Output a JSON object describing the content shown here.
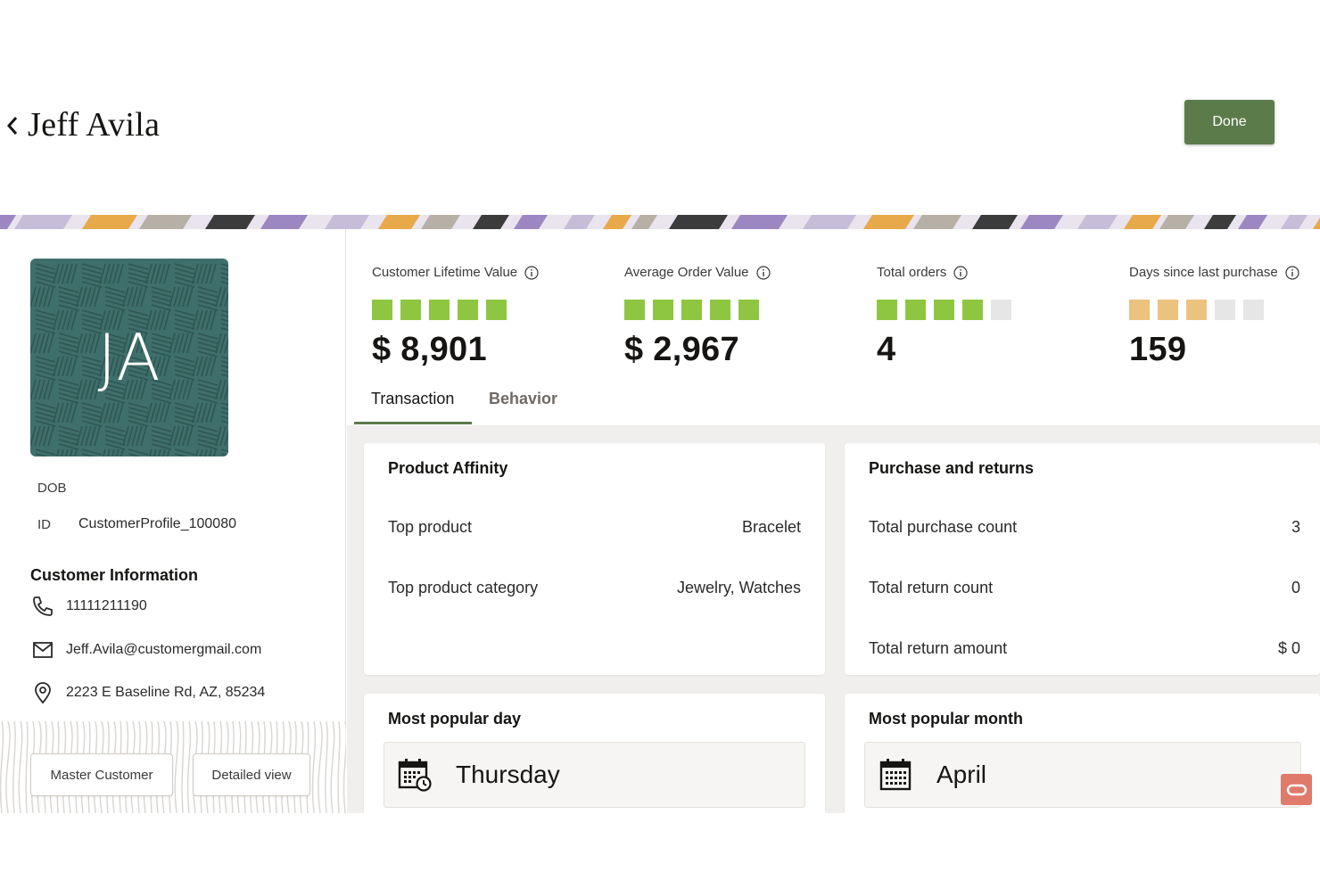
{
  "header": {
    "title": "Jeff Avila",
    "back_icon": "chevron-left-icon",
    "done_label": "Done",
    "accent": "#5c7b4b"
  },
  "profile": {
    "initials": "JA",
    "avatar_color": "#3f6f6b",
    "dob_label": "DOB",
    "id_label": "ID",
    "id_value": "CustomerProfile_100080"
  },
  "customer_info": {
    "title": "Customer Information",
    "phone": "11111211190",
    "email": "Jeff.Avila@customergmail.com",
    "address": "2223 E Baseline Rd, AZ, 85234"
  },
  "footer_buttons": {
    "master": "Master Customer",
    "detailed": "Detailed view"
  },
  "metrics": [
    {
      "label": "Customer Lifetime Value",
      "value": "$ 8,901",
      "level": 5,
      "of": 5,
      "color": "#8fc641"
    },
    {
      "label": "Average Order Value",
      "value": "$ 2,967",
      "level": 5,
      "of": 5,
      "color": "#8fc641"
    },
    {
      "label": "Total orders",
      "value": "4",
      "level": 4,
      "of": 5,
      "color": "#8fc641"
    },
    {
      "label": "Days since last purchase",
      "value": "159",
      "level": 3,
      "of": 5,
      "color": "#ecc27f"
    }
  ],
  "tabs": {
    "transaction": "Transaction",
    "behavior": "Behavior"
  },
  "product_affinity": {
    "title": "Product Affinity",
    "top_product_label": "Top product",
    "top_product_value": "Bracelet",
    "top_category_label": "Top product category",
    "top_category_value": "Jewelry, Watches"
  },
  "purchase_returns": {
    "title": "Purchase and returns",
    "purchase_count_label": "Total purchase count",
    "purchase_count_value": "3",
    "return_count_label": "Total return count",
    "return_count_value": "0",
    "return_amount_label": "Total return amount",
    "return_amount_value": "$ 0"
  },
  "popular_day": {
    "title": "Most popular day",
    "value": "Thursday",
    "icon": "calendar-clock-icon"
  },
  "popular_month": {
    "title": "Most popular month",
    "value": "April",
    "icon": "calendar-icon"
  },
  "colors": {
    "empty_bar": "#e6e6e6",
    "oracle_red": "#e07a6a"
  }
}
